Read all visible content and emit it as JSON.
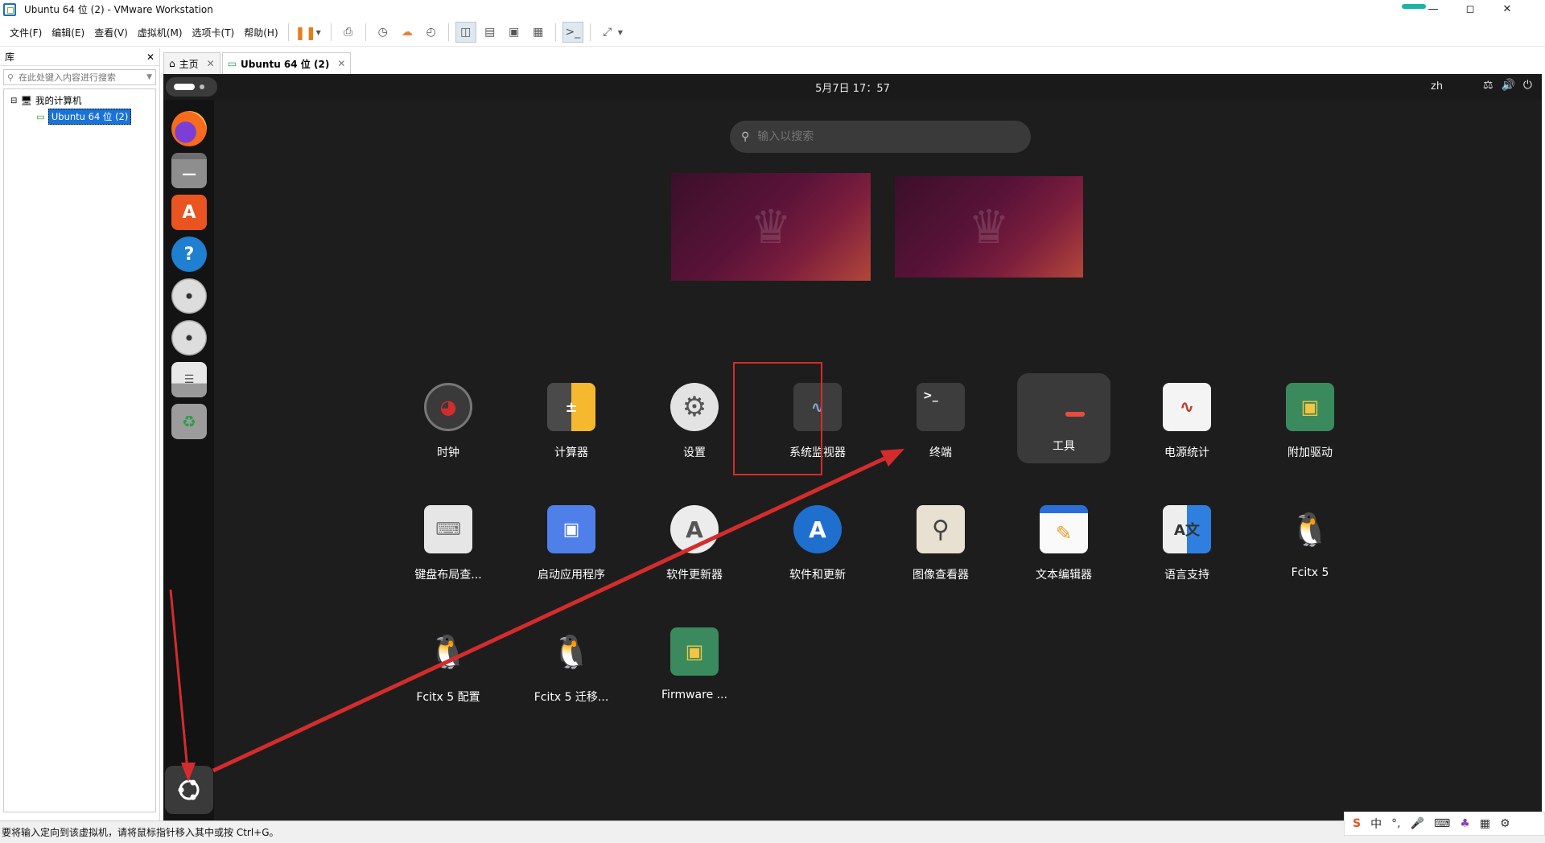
{
  "window": {
    "title": "Ubuntu 64 位 (2) - VMware Workstation"
  },
  "menu": [
    "文件(F)",
    "编辑(E)",
    "查看(V)",
    "虚拟机(M)",
    "选项卡(T)",
    "帮助(H)"
  ],
  "library": {
    "title": "库",
    "search_placeholder": "在此处键入内容进行搜索",
    "root": "我的计算机",
    "vm": "Ubuntu 64 位 (2)"
  },
  "tabs": {
    "home": "主页",
    "vm": "Ubuntu 64 位 (2)"
  },
  "topbar": {
    "datetime": "5月7日 17：57",
    "ime": "zh"
  },
  "search": {
    "placeholder": "输入以搜索"
  },
  "apps": {
    "clock": "时钟",
    "calculator": "计算器",
    "settings": "设置",
    "monitor": "系统监视器",
    "terminal": "终端",
    "tools": "工具",
    "power": "电源统计",
    "drivers": "附加驱动",
    "keyboard": "键盘布局查...",
    "startup": "启动应用程序",
    "updater": "软件更新器",
    "software": "软件和更新",
    "image_viewer": "图像查看器",
    "text_editor": "文本编辑器",
    "language": "语言支持",
    "fcitx": "Fcitx 5",
    "fcitx_config": "Fcitx 5 配置",
    "fcitx_migrate": "Fcitx 5 迁移...",
    "firmware": "Firmware ..."
  },
  "status": {
    "text": "要将输入定向到该虚拟机，请将鼠标指针移入其中或按 Ctrl+G。"
  },
  "tray": {
    "ime": "中"
  },
  "colors": {
    "accent": "#1a73d6",
    "annotation": "#d42c2c",
    "ubuntu_orange": "#e95420"
  }
}
